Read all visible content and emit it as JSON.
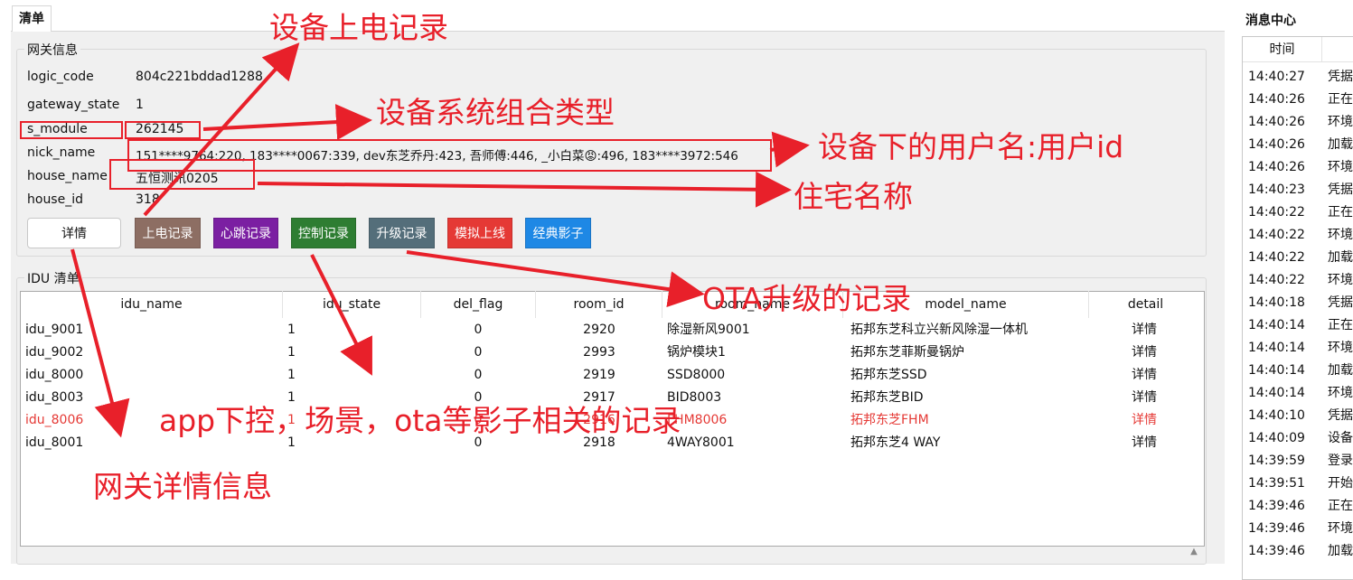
{
  "tab": {
    "label": "清单"
  },
  "gateway": {
    "title": "网关信息",
    "fields": [
      {
        "label": "logic_code",
        "value": "804c221bddad1288"
      },
      {
        "label": "gateway_state",
        "value": "1"
      },
      {
        "label": "s_module",
        "value": "262145"
      },
      {
        "label": "nick_name",
        "value": "151****9764:220, 183****0067:339, dev东芝乔丹:423, 吾师傅:446, _小白菜😡:496, 183****3972:546"
      },
      {
        "label": "house_name",
        "value": "五恒测讯0205"
      },
      {
        "label": "house_id",
        "value": "318"
      }
    ],
    "buttons": [
      {
        "label": "详情",
        "color": "#ffffff"
      },
      {
        "label": "上电记录",
        "color": "#8d6e63"
      },
      {
        "label": "心跳记录",
        "color": "#7b1fa2"
      },
      {
        "label": "控制记录",
        "color": "#2e7d32"
      },
      {
        "label": "升级记录",
        "color": "#546e7a"
      },
      {
        "label": "模拟上线",
        "color": "#e53935"
      },
      {
        "label": "经典影子",
        "color": "#1e88e5"
      }
    ]
  },
  "idu": {
    "title": "IDU 清单",
    "columns": [
      "idu_name",
      "idu_state",
      "del_flag",
      "room_id",
      "room_name",
      "model_name",
      "detail"
    ],
    "rows": [
      {
        "idu_name": "idu_9001",
        "idu_state": "1",
        "del_flag": "0",
        "room_id": "2920",
        "room_name": "除湿新风9001",
        "model_name": "拓邦东芝科立兴新风除湿一体机",
        "detail": "详情",
        "highlight": false
      },
      {
        "idu_name": "idu_9002",
        "idu_state": "1",
        "del_flag": "0",
        "room_id": "2993",
        "room_name": "锅炉模块1",
        "model_name": "拓邦东芝菲斯曼锅炉",
        "detail": "详情",
        "highlight": false
      },
      {
        "idu_name": "idu_8000",
        "idu_state": "1",
        "del_flag": "0",
        "room_id": "2919",
        "room_name": "SSD8000",
        "model_name": "拓邦东芝SSD",
        "detail": "详情",
        "highlight": false
      },
      {
        "idu_name": "idu_8003",
        "idu_state": "1",
        "del_flag": "0",
        "room_id": "2917",
        "room_name": "BID8003",
        "model_name": "拓邦东芝BID",
        "detail": "详情",
        "highlight": false
      },
      {
        "idu_name": "idu_8006",
        "idu_state": "1",
        "del_flag": "0",
        "room_id": "2916",
        "room_name": "FHM8006",
        "model_name": "拓邦东芝FHM",
        "detail": "详情",
        "highlight": true
      },
      {
        "idu_name": "idu_8001",
        "idu_state": "1",
        "del_flag": "0",
        "room_id": "2918",
        "room_name": "4WAY8001",
        "model_name": "拓邦东芝4 WAY",
        "detail": "详情",
        "highlight": false
      }
    ],
    "highlight_color": "#e53935"
  },
  "annotations": {
    "power_on": "设备上电记录",
    "s_module": "设备系统组合类型",
    "users": "设备下的用户名:用户id",
    "house": "住宅名称",
    "ota": "OTA升级的记录",
    "shadow": "app下控，场景，ota等影子相关的记录",
    "detail": "网关详情信息",
    "color": "#e8202a"
  },
  "messages": {
    "title": "消息中心",
    "time_header": "时间",
    "rows": [
      {
        "time": "14:40:27",
        "msg": "凭据"
      },
      {
        "time": "14:40:26",
        "msg": "正在"
      },
      {
        "time": "14:40:26",
        "msg": "环境"
      },
      {
        "time": "14:40:26",
        "msg": "加载"
      },
      {
        "time": "14:40:26",
        "msg": "环境"
      },
      {
        "time": "14:40:23",
        "msg": "凭据"
      },
      {
        "time": "14:40:22",
        "msg": "正在"
      },
      {
        "time": "14:40:22",
        "msg": "环境"
      },
      {
        "time": "14:40:22",
        "msg": "加载"
      },
      {
        "time": "14:40:22",
        "msg": "环境"
      },
      {
        "time": "14:40:18",
        "msg": "凭据"
      },
      {
        "time": "14:40:14",
        "msg": "正在"
      },
      {
        "time": "14:40:14",
        "msg": "环境"
      },
      {
        "time": "14:40:14",
        "msg": "加载"
      },
      {
        "time": "14:40:14",
        "msg": "环境"
      },
      {
        "time": "14:40:10",
        "msg": "凭据"
      },
      {
        "time": "14:40:09",
        "msg": "设备"
      },
      {
        "time": "14:39:59",
        "msg": "登录"
      },
      {
        "time": "14:39:51",
        "msg": "开始"
      },
      {
        "time": "14:39:46",
        "msg": "正在"
      },
      {
        "time": "14:39:46",
        "msg": "环境"
      },
      {
        "time": "14:39:46",
        "msg": "加载"
      }
    ]
  }
}
